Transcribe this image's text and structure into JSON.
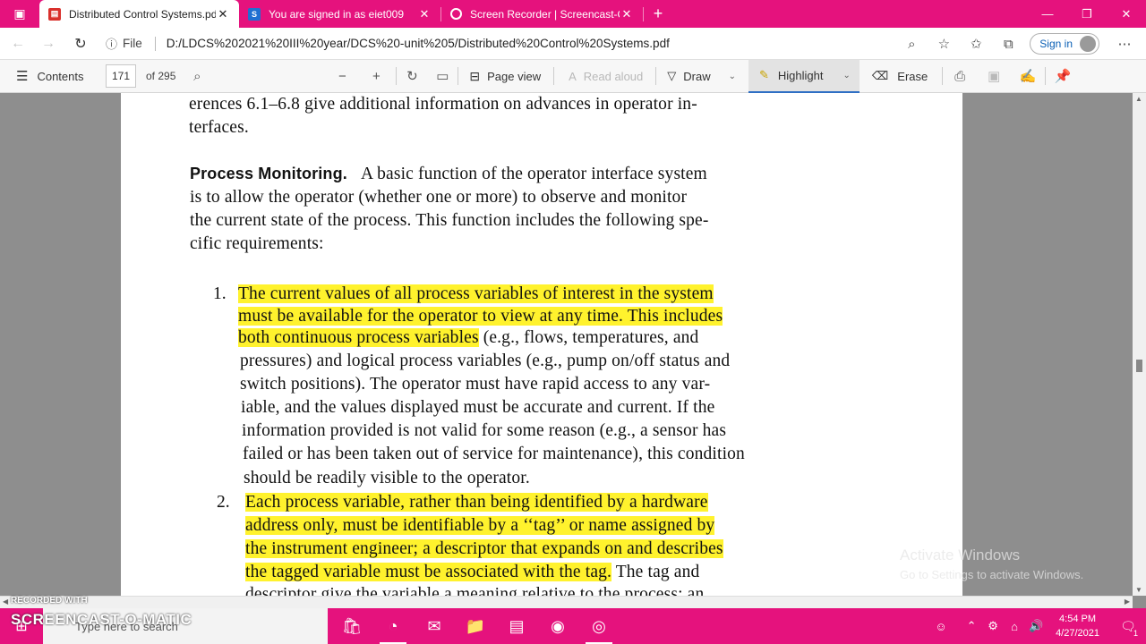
{
  "browser": {
    "tabs": [
      {
        "title": "Distributed Control Systems.pdf",
        "icon": "pdf-icon",
        "active": true
      },
      {
        "title": "You are signed in as eiet009",
        "icon": "s-site-icon",
        "active": false
      },
      {
        "title": "Screen Recorder | Screencast-O-",
        "icon": "screencast-icon",
        "active": false
      }
    ],
    "url_prefix": "File",
    "url": "D:/LDCS%202021%20III%20year/DCS%20-unit%205/Distributed%20Control%20Systems.pdf",
    "sign_in_label": "Sign in"
  },
  "pdf_toolbar": {
    "contents_label": "Contents",
    "page_current": "171",
    "page_total": "of 295",
    "page_view_label": "Page view",
    "read_aloud_label": "Read aloud",
    "draw_label": "Draw",
    "highlight_label": "Highlight",
    "erase_label": "Erase"
  },
  "document": {
    "lines": [
      "erences 6.1–6.8 give additional information on advances in operator in-",
      "terfaces.",
      "A basic function of the operator interface system",
      "is to allow the operator (whether one or more) to observe and monitor",
      "the current state of the process. This function includes the following spe-",
      "cific requirements:",
      "The current values of all process variables of interest in the system",
      "must be available for the operator to view at any time. This includes",
      "both continuous process variables",
      " (e.g., flows, temperatures, and",
      "pressures) and logical process variables (e.g., pump on/off status and",
      "switch positions). The operator must have rapid access to any var-",
      "iable, and the values displayed must be accurate and current. If the",
      "information provided is not valid for some reason (e.g., a sensor has",
      "failed or has been taken out of service for maintenance), this condition",
      "should be readily visible to the operator.",
      "Each process variable, rather than being identified by a hardware",
      "address only, must be identifiable by a ‘‘tag’’ or name assigned by",
      "the instrument engineer; a descriptor that expands on and describes",
      "the tagged variable must be associated with the tag.",
      " The tag and",
      "descriptor give the variable a meaning relative to the process; an"
    ],
    "heading": "Process Monitoring.",
    "item_numbers": [
      "1.",
      "2."
    ]
  },
  "overlay": {
    "activate_title": "Activate Windows",
    "activate_sub": "Go to Settings to activate Windows.",
    "recorded_with": "RECORDED WITH",
    "screencast_brand": "SCREENCAST-O-MATIC"
  },
  "taskbar": {
    "search_placeholder": "Type here to search",
    "time": "4:54 PM",
    "date": "4/27/2021",
    "notification_count": "1"
  },
  "colors": {
    "accent": "#e5127d",
    "highlight": "#fff22d"
  }
}
